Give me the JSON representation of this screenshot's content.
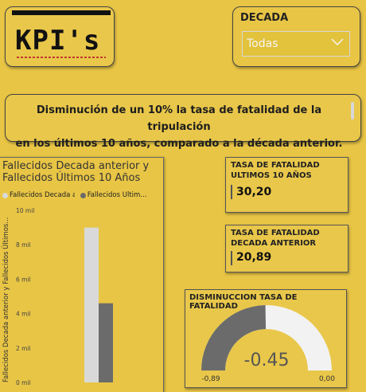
{
  "kpi_title": {
    "text": "KPI's"
  },
  "slicer": {
    "label": "DECADA",
    "selected": "Todas",
    "icon": "chevron-down-icon"
  },
  "banner": {
    "line1": "Disminución de un 10% la tasa de fatalidad de la tripulación",
    "line2": "en los últimos 10 años, comparado a la década anterior."
  },
  "column_chart": {
    "title_line1": "Fallecidos Decada anterior y",
    "title_line2": "Fallecidos Últimos 10 Años",
    "legend": [
      {
        "label": "Fallecidos Decada ante...",
        "color": "#d9d9d9"
      },
      {
        "label": "Fallecidos Últim...",
        "color": "#6b6b6b"
      }
    ],
    "y_axis_label": "Fallecidos Decada anterior y Fallecidos Últimos..."
  },
  "chart_data": {
    "type": "bar",
    "categories": [
      ""
    ],
    "series": [
      {
        "name": "Fallecidos Decada ante...",
        "values": [
          9000
        ],
        "color": "#d9d9d9"
      },
      {
        "name": "Fallecidos Últim...",
        "values": [
          4600
        ],
        "color": "#6b6b6b"
      }
    ],
    "ylim": [
      0,
      10000
    ],
    "yticks": [
      "0 mil",
      "2 mil",
      "4 mil",
      "6 mil",
      "8 mil",
      "10 mil"
    ],
    "ytick_values": [
      0,
      2000,
      4000,
      6000,
      8000,
      10000
    ],
    "title": "Fallecidos Decada anterior y Fallecidos Últimos 10 Años",
    "ylabel": "Fallecidos Decada anterior y Fallecidos Últimos...",
    "xlabel": ""
  },
  "card_ultimos": {
    "label_line1": "TASA DE FATALIDAD",
    "label_line2": "ULTIMOS 10 AÑOS",
    "value": "30,20"
  },
  "card_anterior": {
    "label_line1": "TASA DE FATALIDAD",
    "label_line2": "DECADA ANTERIOR",
    "value": "20,89"
  },
  "gauge": {
    "title": "DISMINUCCION TASA DE FATALIDAD",
    "value": "-0.45",
    "min_label": "-0,89",
    "max_label": "0,00",
    "min": -0.89,
    "max": 0.0,
    "current": -0.45,
    "fill_color": "#6b6b6b",
    "track_color": "#f2f2f2"
  }
}
